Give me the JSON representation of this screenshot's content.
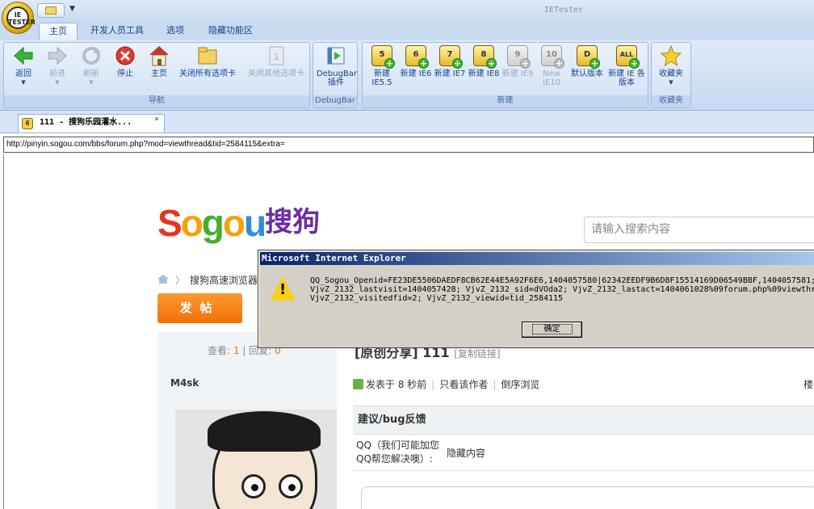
{
  "window": {
    "title": "IETester",
    "app_button_label": "IE\nTESTER"
  },
  "ribbon_tabs": [
    {
      "label": "主页",
      "active": true
    },
    {
      "label": "开发人员工具",
      "active": false
    },
    {
      "label": "选项",
      "active": false
    },
    {
      "label": "隐藏功能区",
      "active": false
    }
  ],
  "ribbon": {
    "nav_group": {
      "label": "导航",
      "buttons": [
        {
          "label": "返回",
          "icon": "back-arrow-icon",
          "enabled": true
        },
        {
          "label": "前进",
          "icon": "forward-arrow-icon",
          "enabled": false
        },
        {
          "label": "刷新",
          "icon": "refresh-icon",
          "enabled": false
        },
        {
          "label": "停止",
          "icon": "stop-icon",
          "enabled": true
        },
        {
          "label": "主页",
          "icon": "home-icon",
          "enabled": true
        },
        {
          "label": "关闭所有选项卡",
          "icon": "folder-icon",
          "enabled": true
        },
        {
          "label": "关闭其他选项卡",
          "icon": "page-icon",
          "enabled": false
        }
      ]
    },
    "debugbar_group": {
      "label": "DebugBar",
      "button_label": "DebugBar 插件"
    },
    "new_group": {
      "label": "新建",
      "buttons": [
        {
          "badge": "5",
          "label": "新建 IE5.5",
          "enabled": true
        },
        {
          "badge": "6",
          "label": "新建 IE6",
          "enabled": true
        },
        {
          "badge": "7",
          "label": "新建 IE7",
          "enabled": true
        },
        {
          "badge": "8",
          "label": "新建 IE8",
          "enabled": true
        },
        {
          "badge": "9",
          "label": "新建 IE9",
          "enabled": false
        },
        {
          "badge": "10",
          "label": "New IE10",
          "enabled": false
        },
        {
          "badge": "D",
          "label": "默认版本",
          "enabled": true
        },
        {
          "badge": "ALL",
          "label": "新建 IE 各版本",
          "enabled": true
        }
      ]
    },
    "favorites_group": {
      "label": "收藏夹",
      "button_label": "收藏夹"
    }
  },
  "doc_tab": {
    "version": "6",
    "title": "111 - 搜狗乐园灌水...",
    "close": "×"
  },
  "address": "http://pinyin.sogou.com/bbs/forum.php?mod=viewthread&tid=2584115&extra=",
  "page": {
    "logo_latin": [
      "S",
      "o",
      "g",
      "o",
      "u"
    ],
    "logo_cn": "搜狗",
    "search_placeholder": "请输入搜索内容",
    "breadcrumb": "搜狗高速浏览器",
    "post_button": "发帖",
    "stats_views_label": "查看:",
    "stats_views": "1",
    "stats_sep": "|",
    "stats_replies_label": "回复:",
    "stats_replies": "0",
    "author": "M4sk",
    "title_text": "[原创分享] 111",
    "copy_link": "[复制链接]",
    "posted": "发表于 8 秒前",
    "only_author": "只看该作者",
    "reverse": "倒序浏览",
    "floor": "楼",
    "feedback_title": "建议/bug反馈",
    "qq_label_line1": "QQ（我们可能加您",
    "qq_label_line2": "QQ帮您解决噢）:",
    "hidden_content": "隐藏内容"
  },
  "dialog": {
    "title": "Microsoft Internet Explorer",
    "text": "QQ_Sogou_Openid=FE23DE5506DAEDF8CB62E44E5A92F6E6,1404057580|62342EEDF9B6D8F15514169D06549BBF,1404057581;\nVjvZ_2132_lastvisit=1404057428; VjvZ_2132_sid=dVOda2; VjvZ_2132_lastact=1404061028%09forum.php%09viewthr\nVjvZ_2132_visitedfid=2; VjvZ_2132_viewid=tid_2584115",
    "ok": "确定"
  }
}
